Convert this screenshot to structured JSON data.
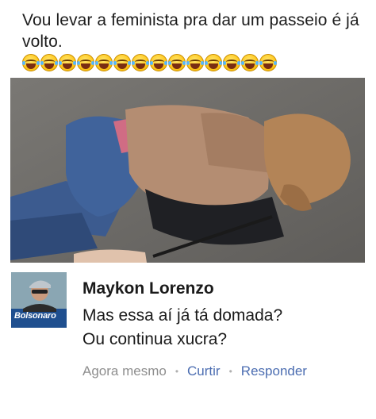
{
  "post": {
    "caption": "Vou levar a feminista pra dar um passeio é já volto.",
    "emoji_count": 14,
    "emoji_icon": "laughing-tears-emoji"
  },
  "comment": {
    "author": "Maykon Lorenzo",
    "avatar_label": "Bolsonaro",
    "text_line1": "Mas essa aí já tá domada?",
    "text_line2": "Ou continua xucra?",
    "timestamp": "Agora mesmo",
    "like_label": "Curtir",
    "reply_label": "Responder",
    "separator": "•"
  },
  "colors": {
    "link": "#4b6db1",
    "meta": "#8e8e8e"
  }
}
